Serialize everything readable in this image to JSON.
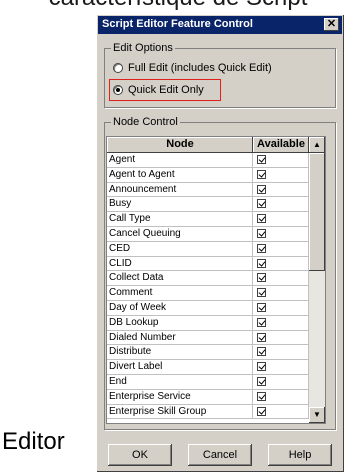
{
  "background": {
    "top_caption": "característique de Script",
    "bottom_word": "Editor"
  },
  "window": {
    "title": "Script Editor Feature Control",
    "close_symbol": "✕"
  },
  "edit_options": {
    "label": "Edit Options",
    "full_edit": "Full Edit (includes Quick Edit)",
    "quick_edit": "Quick Edit Only",
    "selected": "quick_edit",
    "highlight_color": "#e0201c"
  },
  "node_control": {
    "label": "Node Control",
    "columns": [
      "Node",
      "Available"
    ],
    "rows": [
      {
        "node": "Agent",
        "available": true
      },
      {
        "node": "Agent to Agent",
        "available": true
      },
      {
        "node": "Announcement",
        "available": true
      },
      {
        "node": "Busy",
        "available": true
      },
      {
        "node": "Call Type",
        "available": true
      },
      {
        "node": "Cancel Queuing",
        "available": true
      },
      {
        "node": "CED",
        "available": true
      },
      {
        "node": "CLID",
        "available": true
      },
      {
        "node": "Collect Data",
        "available": true
      },
      {
        "node": "Comment",
        "available": true
      },
      {
        "node": "Day of Week",
        "available": true
      },
      {
        "node": "DB Lookup",
        "available": true
      },
      {
        "node": "Dialed Number",
        "available": true
      },
      {
        "node": "Distribute",
        "available": true
      },
      {
        "node": "Divert Label",
        "available": true
      },
      {
        "node": "End",
        "available": true
      },
      {
        "node": "Enterprise Service",
        "available": true
      },
      {
        "node": "Enterprise Skill Group",
        "available": true
      }
    ],
    "scroll_up_icon": "▲",
    "scroll_down_icon": "▼"
  },
  "buttons": {
    "ok": "OK",
    "cancel": "Cancel",
    "help": "Help"
  },
  "colors": {
    "titlebar": "#0a246a",
    "face": "#d4d0c8"
  }
}
